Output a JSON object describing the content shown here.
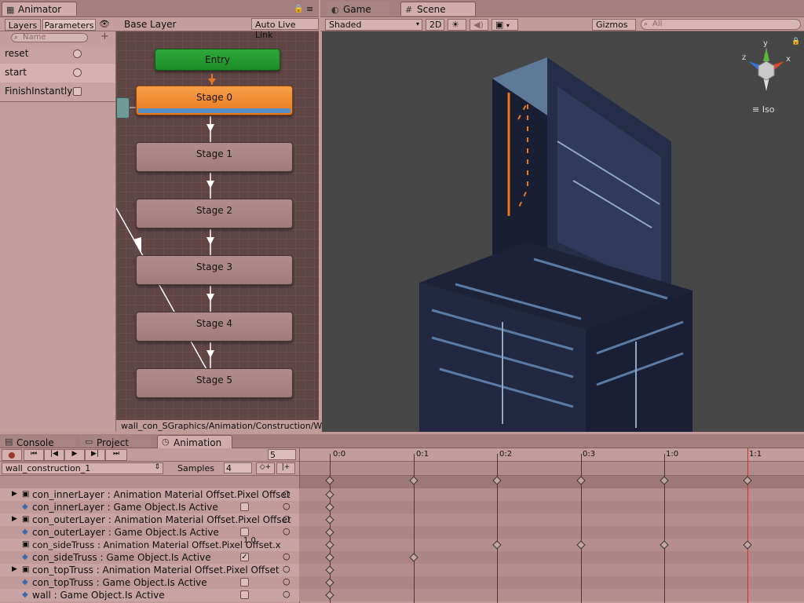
{
  "animator": {
    "tab_label": "Animator",
    "subtabs": [
      "Layers",
      "Parameters"
    ],
    "search_placeholder": "Name",
    "add_symbol": "+",
    "parameters": [
      {
        "name": "reset",
        "kind": "trigger"
      },
      {
        "name": "start",
        "kind": "trigger"
      },
      {
        "name": "FinishInstantly",
        "kind": "bool"
      }
    ],
    "breadcrumb": "Base Layer",
    "auto_live_link": "Auto Live Link",
    "nodes": {
      "entry": "Entry",
      "stages": [
        "Stage 0",
        "Stage 1",
        "Stage 2",
        "Stage 3",
        "Stage 4",
        "Stage 5"
      ]
    },
    "path": "wall_con_SGraphics/Animation/Construction/Wall"
  },
  "scene": {
    "tabs": [
      "Game",
      "Scene"
    ],
    "shading": "Shaded",
    "mode_2d": "2D",
    "gizmos": "Gizmos",
    "search_placeholder": "All",
    "projection": "Iso",
    "axes": {
      "x": "x",
      "y": "y",
      "z": "z"
    }
  },
  "bottom": {
    "tabs": [
      "Console",
      "Project",
      "Animation"
    ],
    "frame": "5",
    "clip": "wall_construction_1",
    "samples_label": "Samples",
    "samples_value": "4",
    "time_labels": [
      "0:0",
      "0:1",
      "0:2",
      "0:3",
      "1:0",
      "1:1"
    ],
    "value_tooltip": "1.0",
    "properties": [
      {
        "label": "con_innerLayer : Animation Material Offset.Pixel Offset",
        "expand": true,
        "toggle": "none"
      },
      {
        "label": "con_innerLayer : Game Object.Is Active",
        "expand": false,
        "toggle": "off"
      },
      {
        "label": "con_outerLayer : Animation Material Offset.Pixel Offset",
        "expand": true,
        "toggle": "none"
      },
      {
        "label": "con_outerLayer : Game Object.Is Active",
        "expand": false,
        "toggle": "off"
      },
      {
        "label": "con_sideTruss : Animation Material Offset.Pixel Offset.x",
        "expand": false,
        "toggle": "none"
      },
      {
        "label": "con_sideTruss : Game Object.Is Active",
        "expand": false,
        "toggle": "on"
      },
      {
        "label": "con_topTruss : Animation Material Offset.Pixel Offset",
        "expand": true,
        "toggle": "none"
      },
      {
        "label": "con_topTruss : Game Object.Is Active",
        "expand": false,
        "toggle": "off"
      },
      {
        "label": "wall : Game Object.Is Active",
        "expand": false,
        "toggle": "off"
      }
    ]
  },
  "colors": {
    "accent_orange": "#e7771f",
    "entry_green": "#1d8c2a",
    "playhead": "#d0301c"
  }
}
